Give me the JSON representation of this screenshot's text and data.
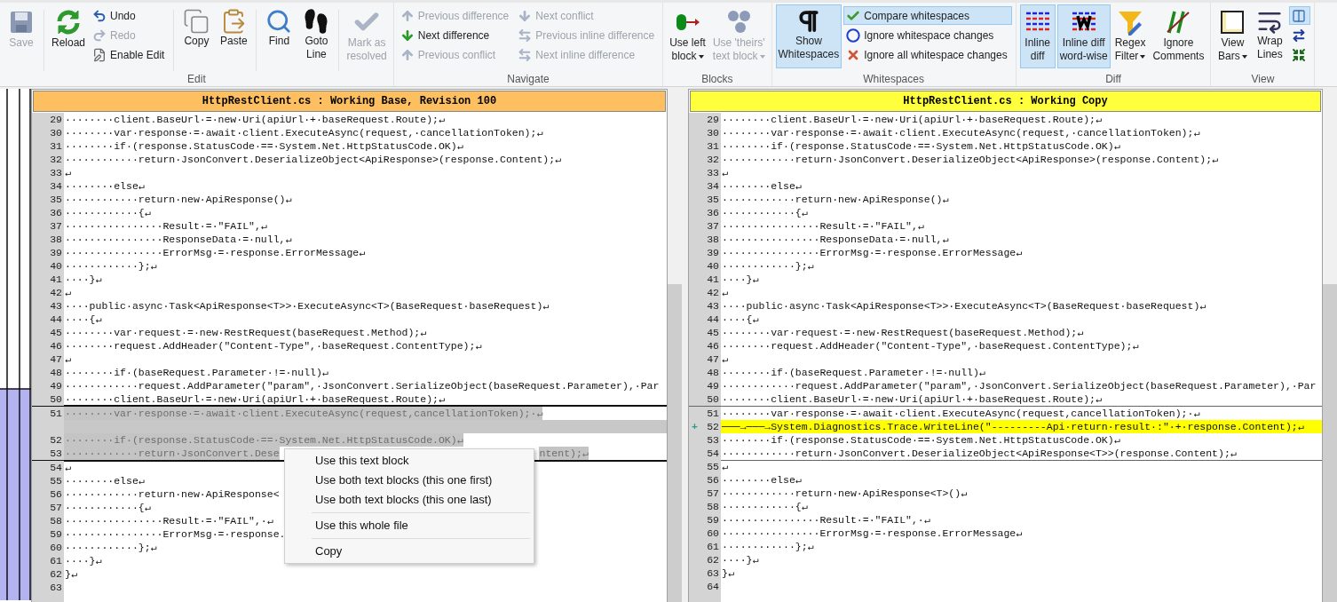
{
  "ribbon": {
    "groups": [
      {
        "label": "Edit",
        "items": [
          {
            "kind": "large",
            "lines": [
              "Save"
            ],
            "disabled": true,
            "selected": false,
            "dropdown": false
          },
          {
            "kind": "separator"
          },
          {
            "kind": "large",
            "lines": [
              "Reload"
            ],
            "disabled": false,
            "selected": false,
            "dropdown": false
          },
          {
            "kind": "stack",
            "items": [
              {
                "label": "Undo",
                "disabled": false,
                "selected": false
              },
              {
                "label": "Redo",
                "disabled": true,
                "selected": false
              },
              {
                "label": "Enable Edit",
                "disabled": false,
                "selected": false
              }
            ]
          },
          {
            "kind": "separator"
          },
          {
            "kind": "large",
            "lines": [
              "Copy"
            ],
            "disabled": false,
            "selected": false,
            "dropdown": false
          },
          {
            "kind": "large",
            "lines": [
              "Paste"
            ],
            "disabled": false,
            "selected": false,
            "dropdown": false
          },
          {
            "kind": "separator"
          },
          {
            "kind": "large",
            "lines": [
              "Find"
            ],
            "disabled": false,
            "selected": false,
            "dropdown": false
          },
          {
            "kind": "large",
            "lines": [
              "Goto",
              "Line"
            ],
            "disabled": false,
            "selected": false,
            "dropdown": false
          },
          {
            "kind": "separator"
          },
          {
            "kind": "large",
            "lines": [
              "Mark as",
              "resolved"
            ],
            "disabled": true,
            "selected": false,
            "dropdown": false
          }
        ]
      },
      {
        "label": "Navigate",
        "items": [
          {
            "kind": "stack",
            "items": [
              {
                "label": "Previous difference",
                "disabled": true,
                "selected": false
              },
              {
                "label": "Next difference",
                "disabled": false,
                "selected": false
              },
              {
                "label": "Previous conflict",
                "disabled": true,
                "selected": false
              }
            ]
          },
          {
            "kind": "stack",
            "items": [
              {
                "label": "Next conflict",
                "disabled": true,
                "selected": false
              },
              {
                "label": "Previous inline difference",
                "disabled": true,
                "selected": false
              },
              {
                "label": "Next inline difference",
                "disabled": true,
                "selected": false
              }
            ]
          }
        ]
      },
      {
        "label": "Blocks",
        "items": [
          {
            "kind": "large",
            "lines": [
              "Use left",
              "block"
            ],
            "disabled": false,
            "selected": false,
            "dropdown": true
          },
          {
            "kind": "large",
            "lines": [
              "Use 'theirs'",
              "text block"
            ],
            "disabled": true,
            "selected": false,
            "dropdown": true
          }
        ]
      },
      {
        "label": "Whitespaces",
        "items": [
          {
            "kind": "large",
            "lines": [
              "Show",
              "Whitespaces"
            ],
            "disabled": false,
            "selected": true,
            "dropdown": false
          },
          {
            "kind": "stack",
            "items": [
              {
                "label": "Compare whitespaces",
                "disabled": false,
                "selected": true
              },
              {
                "label": "Ignore whitespace changes",
                "disabled": false,
                "selected": false
              },
              {
                "label": "Ignore all whitespace changes",
                "disabled": false,
                "selected": false
              }
            ]
          }
        ]
      },
      {
        "label": "Diff",
        "items": [
          {
            "kind": "large",
            "lines": [
              "Inline",
              "diff"
            ],
            "disabled": false,
            "selected": true,
            "dropdown": false
          },
          {
            "kind": "large",
            "lines": [
              "Inline diff",
              "word-wise"
            ],
            "disabled": false,
            "selected": true,
            "dropdown": false
          },
          {
            "kind": "large",
            "lines": [
              "Regex",
              "Filter"
            ],
            "disabled": false,
            "selected": false,
            "dropdown": true
          },
          {
            "kind": "large",
            "lines": [
              "Ignore",
              "Comments"
            ],
            "disabled": false,
            "selected": false,
            "dropdown": false
          }
        ]
      },
      {
        "label": "View",
        "items": [
          {
            "kind": "large",
            "lines": [
              "View",
              "Bars"
            ],
            "disabled": false,
            "selected": false,
            "dropdown": true
          },
          {
            "kind": "large",
            "lines": [
              "Wrap",
              "Lines"
            ],
            "disabled": false,
            "selected": false,
            "dropdown": false
          },
          {
            "kind": "stack",
            "items": [
              {
                "disabled": false,
                "selected": true
              },
              {
                "disabled": false,
                "selected": false
              },
              {
                "disabled": false,
                "selected": false
              }
            ]
          }
        ]
      }
    ]
  },
  "panes": [
    {
      "kind": "base",
      "title": "HttpRestClient.cs : Working Base, Revision 100",
      "lines": [
        {
          "kind": "normal",
          "number": "29",
          "text": "········client.BaseUrl·=·new·Uri(apiUrl·+·baseRequest.Route);↵"
        },
        {
          "kind": "normal",
          "number": "30",
          "text": "········var·response·=·await·client.ExecuteAsync(request,·cancellationToken);↵"
        },
        {
          "kind": "normal",
          "number": "31",
          "text": "········if·(response.StatusCode·==·System.Net.HttpStatusCode.OK)↵"
        },
        {
          "kind": "normal",
          "number": "32",
          "text": "············return·JsonConvert.DeserializeObject<ApiResponse>(response.Content);↵"
        },
        {
          "kind": "normal",
          "number": "33",
          "text": "↵"
        },
        {
          "kind": "normal",
          "number": "34",
          "text": "········else↵"
        },
        {
          "kind": "normal",
          "number": "35",
          "text": "············return·new·ApiResponse()↵"
        },
        {
          "kind": "normal",
          "number": "36",
          "text": "············{↵"
        },
        {
          "kind": "normal",
          "number": "37",
          "text": "················Result·=·\"FAIL\",↵"
        },
        {
          "kind": "normal",
          "number": "38",
          "text": "················ResponseData·=·null,↵"
        },
        {
          "kind": "normal",
          "number": "39",
          "text": "················ErrorMsg·=·response.ErrorMessage↵"
        },
        {
          "kind": "normal",
          "number": "40",
          "text": "············};↵"
        },
        {
          "kind": "normal",
          "number": "41",
          "text": "····}↵"
        },
        {
          "kind": "normal",
          "number": "42",
          "text": "↵"
        },
        {
          "kind": "normal",
          "number": "43",
          "text": "····public·async·Task<ApiResponse<T>>·ExecuteAsync<T>(BaseRequest·baseRequest)↵"
        },
        {
          "kind": "normal",
          "number": "44",
          "text": "····{↵"
        },
        {
          "kind": "normal",
          "number": "45",
          "text": "········var·request·=·new·RestRequest(baseRequest.Method);↵"
        },
        {
          "kind": "normal",
          "number": "46",
          "text": "········request.AddHeader(\"Content-Type\",·baseRequest.ContentType);↵"
        },
        {
          "kind": "normal",
          "number": "47",
          "text": "↵"
        },
        {
          "kind": "normal",
          "number": "48",
          "text": "········if·(baseRequest.Parameter·!=·null)↵"
        },
        {
          "kind": "normal",
          "number": "49",
          "text": "············request.AddParameter(\"param\",·JsonConvert.SerializeObject(baseRequest.Parameter),·Par"
        },
        {
          "kind": "normal",
          "number": "50",
          "text": "········client.BaseUrl·=·new·Uri(apiUrl·+·baseRequest.Route);↵"
        },
        {
          "kind": "block",
          "lines": [
            {
              "kind": "changed",
              "number": "51",
              "text": "········var·response·=·await·client.ExecuteAsync(request,cancellationToken);·↵"
            },
            {
              "kind": "ghost"
            },
            {
              "kind": "changed",
              "number": "52",
              "text": "········if·(response.StatusCode·==·System.Net.HttpStatusCode.OK)↵"
            },
            {
              "kind": "changed",
              "number": "53",
              "text": "············return·JsonConvert.Dese",
              "tail": "ntent);↵"
            }
          ]
        },
        {
          "kind": "normal",
          "number": "54",
          "text": "↵"
        },
        {
          "kind": "normal",
          "number": "55",
          "text": "········else↵"
        },
        {
          "kind": "normal",
          "number": "56",
          "text": "············return·new·ApiResponse<"
        },
        {
          "kind": "normal",
          "number": "57",
          "text": "············{↵"
        },
        {
          "kind": "normal",
          "number": "58",
          "text": "················Result·=·\"FAIL\",·↵"
        },
        {
          "kind": "normal",
          "number": "59",
          "text": "················ErrorMsg·=·response."
        },
        {
          "kind": "normal",
          "number": "60",
          "text": "············};↵"
        },
        {
          "kind": "normal",
          "number": "61",
          "text": "····}↵"
        },
        {
          "kind": "normal",
          "number": "62",
          "text": "}↵"
        },
        {
          "kind": "normal",
          "number": "63"
        }
      ]
    },
    {
      "kind": "working",
      "title": "HttpRestClient.cs : Working Copy",
      "lines": [
        {
          "kind": "normal",
          "number": "29",
          "text": "········client.BaseUrl·=·new·Uri(apiUrl·+·baseRequest.Route);↵"
        },
        {
          "kind": "normal",
          "number": "30",
          "text": "········var·response·=·await·client.ExecuteAsync(request,·cancellationToken);↵"
        },
        {
          "kind": "normal",
          "number": "31",
          "text": "········if·(response.StatusCode·==·System.Net.HttpStatusCode.OK)↵"
        },
        {
          "kind": "normal",
          "number": "32",
          "text": "············return·JsonConvert.DeserializeObject<ApiResponse>(response.Content);↵"
        },
        {
          "kind": "normal",
          "number": "33",
          "text": "↵"
        },
        {
          "kind": "normal",
          "number": "34",
          "text": "········else↵"
        },
        {
          "kind": "normal",
          "number": "35",
          "text": "············return·new·ApiResponse()↵"
        },
        {
          "kind": "normal",
          "number": "36",
          "text": "············{↵"
        },
        {
          "kind": "normal",
          "number": "37",
          "text": "················Result·=·\"FAIL\",↵"
        },
        {
          "kind": "normal",
          "number": "38",
          "text": "················ResponseData·=·null,↵"
        },
        {
          "kind": "normal",
          "number": "39",
          "text": "················ErrorMsg·=·response.ErrorMessage↵"
        },
        {
          "kind": "normal",
          "number": "40",
          "text": "············};↵"
        },
        {
          "kind": "normal",
          "number": "41",
          "text": "····}↵"
        },
        {
          "kind": "normal",
          "number": "42",
          "text": "↵"
        },
        {
          "kind": "normal",
          "number": "43",
          "text": "····public·async·Task<ApiResponse<T>>·ExecuteAsync<T>(BaseRequest·baseRequest)↵"
        },
        {
          "kind": "normal",
          "number": "44",
          "text": "····{↵"
        },
        {
          "kind": "normal",
          "number": "45",
          "text": "········var·request·=·new·RestRequest(baseRequest.Method);↵"
        },
        {
          "kind": "normal",
          "number": "46",
          "text": "········request.AddHeader(\"Content-Type\",·baseRequest.ContentType);↵"
        },
        {
          "kind": "normal",
          "number": "47",
          "text": "↵"
        },
        {
          "kind": "normal",
          "number": "48",
          "text": "········if·(baseRequest.Parameter·!=·null)↵"
        },
        {
          "kind": "normal",
          "number": "49",
          "text": "············request.AddParameter(\"param\",·JsonConvert.SerializeObject(baseRequest.Parameter),·Par"
        },
        {
          "kind": "normal",
          "number": "50",
          "text": "········client.BaseUrl·=·new·Uri(apiUrl·+·baseRequest.Route);↵"
        },
        {
          "kind": "block",
          "lines": [
            {
              "kind": "normal",
              "number": "51",
              "text": "········var·response·=·await·client.ExecuteAsync(request,cancellationToken);·↵"
            },
            {
              "kind": "added",
              "number": "52",
              "marker": "+",
              "text": "───→───→System.Diagnostics.Trace.WriteLine(\"---------Api·return·result·:\"·+·response.Content);↵"
            },
            {
              "kind": "normal",
              "number": "53",
              "text": "········if·(response.StatusCode·==·System.Net.HttpStatusCode.OK)↵"
            },
            {
              "kind": "normal",
              "number": "54",
              "text": "············return·JsonConvert.DeserializeObject<ApiResponse<T>>(response.Content);↵"
            }
          ]
        },
        {
          "kind": "normal",
          "number": "55",
          "text": "↵"
        },
        {
          "kind": "normal",
          "number": "56",
          "text": "········else↵"
        },
        {
          "kind": "normal",
          "number": "57",
          "text": "············return·new·ApiResponse<T>()↵"
        },
        {
          "kind": "normal",
          "number": "58",
          "text": "············{↵"
        },
        {
          "kind": "normal",
          "number": "59",
          "text": "················Result·=·\"FAIL\",·↵"
        },
        {
          "kind": "normal",
          "number": "60",
          "text": "················ErrorMsg·=·response.ErrorMessage↵"
        },
        {
          "kind": "normal",
          "number": "61",
          "text": "············};↵"
        },
        {
          "kind": "normal",
          "number": "62",
          "text": "····}↵"
        },
        {
          "kind": "normal",
          "number": "63",
          "text": "}↵"
        },
        {
          "kind": "normal",
          "number": "64"
        }
      ]
    }
  ],
  "context_menu": {
    "groups": [
      [
        "Use this text block",
        "Use both text blocks (this one first)",
        "Use both text blocks (this one last)"
      ],
      [
        "Use this whole file"
      ],
      [
        "Copy"
      ]
    ]
  }
}
